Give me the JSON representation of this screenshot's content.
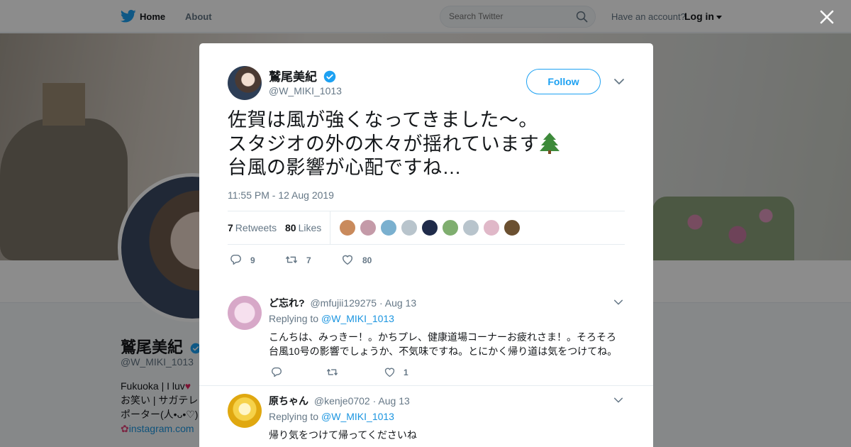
{
  "topbar": {
    "home_label": "Home",
    "about_label": "About",
    "search_placeholder": "Search Twitter",
    "have_account_text": "Have an account?",
    "login_label": "Log in"
  },
  "profile": {
    "name": "鷲尾美紀",
    "handle": "@W_MIKI_1013",
    "bio_line1": "Fukuoka | I luv",
    "bio_line2": "お笑い | サガテレ",
    "bio_line3": "ポーター(人•ᴗ•♡)",
    "bio_link": "instagram.com"
  },
  "tweet": {
    "author_name": "鷲尾美紀",
    "author_handle": "@W_MIKI_1013",
    "follow_label": "Follow",
    "text_line1": "佐賀は風が強くなってきました〜。",
    "text_line2": "スタジオの外の木々が揺れています",
    "text_line3": "台風の影響が心配ですね…",
    "timestamp": "11:55 PM - 12 Aug 2019",
    "retweets_count": "7",
    "retweets_label": "Retweets",
    "likes_count": "80",
    "likes_label": "Likes",
    "reply_count": "9",
    "retweet_action_count": "7",
    "like_action_count": "80",
    "likers_colors": [
      "#c98a5c",
      "#c49aa8",
      "#7ab0cf",
      "#b8c4cc",
      "#1f2b4a",
      "#7fae6f",
      "#b8c4cc",
      "#e0b8c8",
      "#6b5030"
    ]
  },
  "replies": [
    {
      "name": "ど忘れ?",
      "handle": "@mfujii129275",
      "date": "· Aug 13",
      "replying_to_label": "Replying to",
      "replying_to_handle": "@W_MIKI_1013",
      "text": "こんちは、みっきー！。かちプレ、健康道場コーナーお疲れさま！。そろそろ台風10号の影響でしょうか、不気味ですね。とにかく帰り道は気をつけてね。",
      "reply_count": "",
      "retweet_count": "",
      "like_count": "1",
      "avatar_color": "#d7a8c8"
    },
    {
      "name": "原ちゃん",
      "handle": "@kenje0702",
      "date": "· Aug 13",
      "replying_to_label": "Replying to",
      "replying_to_handle": "@W_MIKI_1013",
      "text": "帰り気をつけて帰ってくださいね",
      "avatar_color": "#f0c020"
    }
  ],
  "colors": {
    "accent": "#1da1f2",
    "link": "#1b95e0",
    "text_primary": "#14171a",
    "text_secondary": "#657786"
  }
}
